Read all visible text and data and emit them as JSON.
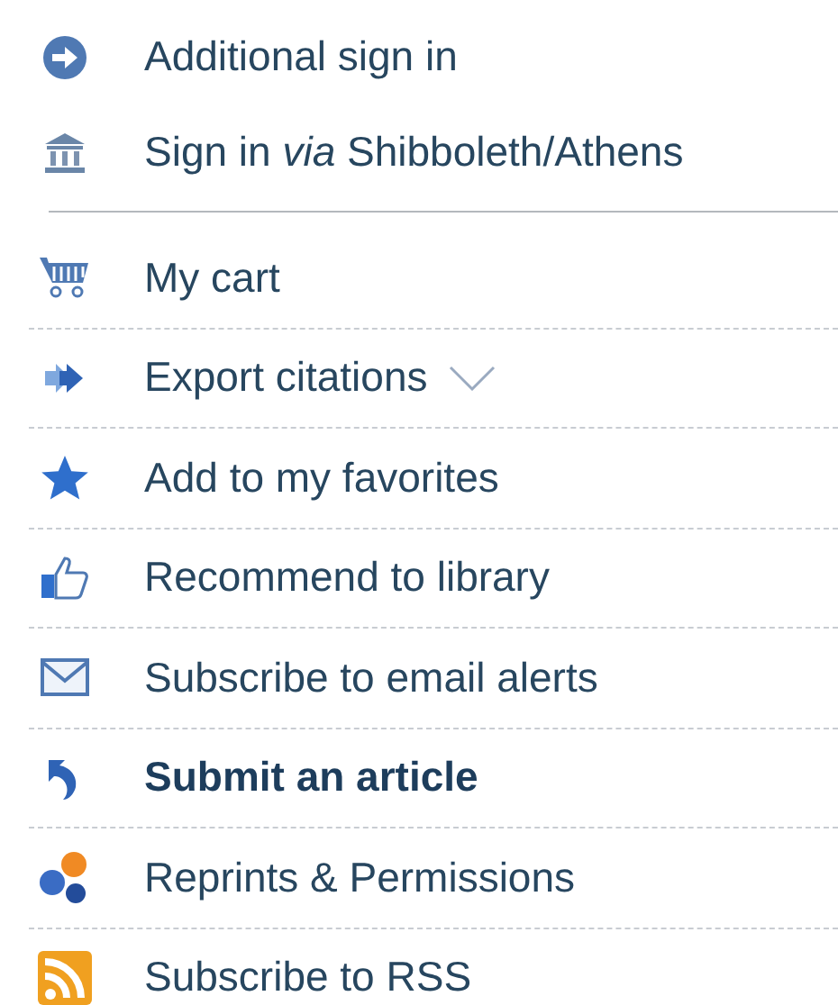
{
  "sign_in_items": [
    {
      "label": "Additional sign in"
    },
    {
      "label": "Sign in *via* Shibboleth/Athens"
    }
  ],
  "actions": [
    {
      "label": "My cart",
      "emphasized": false,
      "dropdown": false
    },
    {
      "label": "Export citations",
      "emphasized": false,
      "dropdown": true
    },
    {
      "label": "Add to my favorites",
      "emphasized": false,
      "dropdown": false
    },
    {
      "label": "Recommend to library",
      "emphasized": false,
      "dropdown": false
    },
    {
      "label": "Subscribe to email alerts",
      "emphasized": false,
      "dropdown": false
    },
    {
      "label": "Submit an article",
      "emphasized": true,
      "dropdown": false
    },
    {
      "label": "Reprints & Permissions",
      "emphasized": false,
      "dropdown": false
    },
    {
      "label": "Subscribe to RSS",
      "emphasized": false,
      "dropdown": false
    }
  ]
}
